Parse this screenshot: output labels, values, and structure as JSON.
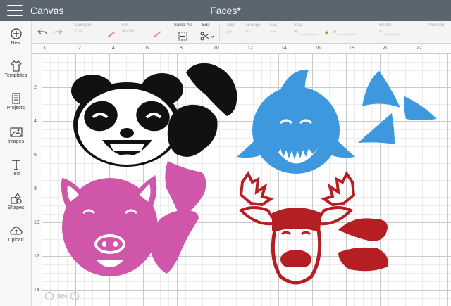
{
  "topbar": {
    "app_title": "Canvas",
    "doc_title": "Faces*"
  },
  "sidebar": {
    "items": [
      {
        "label": "New",
        "icon": "plus-circle-icon"
      },
      {
        "label": "Templates",
        "icon": "shirt-icon"
      },
      {
        "label": "Projects",
        "icon": "projects-icon"
      },
      {
        "label": "Images",
        "icon": "image-icon"
      },
      {
        "label": "Text",
        "icon": "text-t-icon"
      },
      {
        "label": "Shapes",
        "icon": "shapes-icon"
      },
      {
        "label": "Upload",
        "icon": "cloud-upload-icon"
      }
    ]
  },
  "toolbar": {
    "undo_icon": "undo-icon",
    "redo_icon": "redo-icon",
    "linetype": {
      "label": "Linetype",
      "value": "Cut"
    },
    "fill": {
      "label": "Fill",
      "value": "No Fill"
    },
    "select_all": "Select All",
    "edit": "Edit",
    "align": "Align",
    "arrange": "Arrange",
    "flip": "Flip",
    "size": {
      "label": "Size",
      "w": "W",
      "h": "H"
    },
    "rotate": "Rotate",
    "position": "Position"
  },
  "rulers": {
    "top": [
      "0",
      "2",
      "4",
      "6",
      "8",
      "10",
      "12",
      "14",
      "16",
      "18",
      "20",
      "22"
    ],
    "left": [
      "2",
      "4",
      "6",
      "8",
      "10",
      "12",
      "14"
    ]
  },
  "zoom": {
    "minus": "−",
    "value": "50%",
    "plus": "+"
  },
  "colors": {
    "topbar": "#5a6570",
    "panda": "#111111",
    "shark": "#3d98de",
    "pig": "#cf56a8",
    "moose": "#b51f24"
  }
}
